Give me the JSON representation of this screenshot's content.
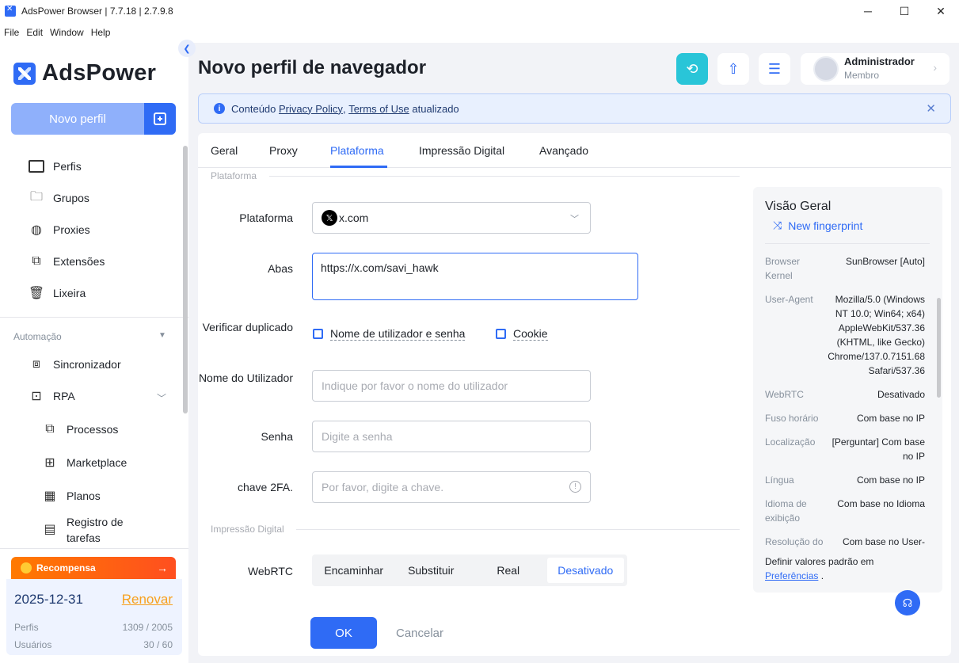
{
  "window": {
    "title": "AdsPower Browser | 7.7.18 | 2.7.9.8"
  },
  "menu": [
    "File",
    "Edit",
    "Window",
    "Help"
  ],
  "sidebar": {
    "logo": "AdsPower",
    "new_profile": "Novo perfil",
    "items": [
      {
        "label": "Perfis",
        "icon": "profiles-icon"
      },
      {
        "label": "Grupos",
        "icon": "folder-icon"
      },
      {
        "label": "Proxies",
        "icon": "globe-icon"
      },
      {
        "label": "Extensões",
        "icon": "puzzle-icon"
      },
      {
        "label": "Lixeira",
        "icon": "trash-icon"
      }
    ],
    "automation_label": "Automação",
    "automation_items": [
      {
        "label": "Sincronizador",
        "icon": "sync-icon"
      },
      {
        "label": "RPA",
        "icon": "robot-icon"
      }
    ],
    "rpa_sub": [
      {
        "label": "Processos",
        "icon": "process-icon"
      },
      {
        "label": "Marketplace",
        "icon": "store-icon"
      },
      {
        "label": "Planos",
        "icon": "calendar-icon"
      },
      {
        "label": "Registro de tarefas",
        "icon": "log-icon"
      }
    ],
    "reward": "Recompensa",
    "plan": {
      "date": "2025-12-31",
      "renew": "Renovar",
      "profiles_label": "Perfis",
      "profiles_value": "1309 / 2005",
      "users_label": "Usuários",
      "users_value": "30 / 60"
    }
  },
  "header": {
    "title": "Novo perfil de navegador",
    "user_name": "Administrador",
    "user_role": "Membro"
  },
  "notice": {
    "prefix": "Conteúdo",
    "link1": "Privacy Policy",
    "comma": ",",
    "link2": "Terms of Use",
    "suffix": "atualizado"
  },
  "tabs": [
    "Geral",
    "Proxy",
    "Plataforma",
    "Impressão Digital",
    "Avançado"
  ],
  "form": {
    "group_platform": "Plataforma",
    "platform_label": "Plataforma",
    "platform_value": "x.com",
    "tabs_label": "Abas",
    "tabs_value": "https://x.com/savi_hawk",
    "dup_label": "Verificar duplicado",
    "dup_opt1": "Nome de utilizador e senha",
    "dup_opt2": "Cookie",
    "user_label": "Nome do Utilizador",
    "user_placeholder": "Indique por favor o nome do utilizador",
    "pass_label": "Senha",
    "pass_placeholder": "Digite a senha",
    "twofa_label": "chave 2FA.",
    "twofa_placeholder": "Por favor, digite a chave.",
    "group_fp": "Impressão Digital",
    "webrtc_label": "WebRTC",
    "webrtc_options": [
      "Encaminhar",
      "Substituir",
      "Real",
      "Desativado"
    ],
    "ok": "OK",
    "cancel": "Cancelar"
  },
  "overview": {
    "title": "Visão Geral",
    "new_fp": "New fingerprint",
    "rows": [
      {
        "k": "Browser Kernel",
        "v": "SunBrowser [Auto]"
      },
      {
        "k": "User-Agent",
        "v": "Mozilla/5.0 (Windows NT 10.0; Win64; x64) AppleWebKit/537.36 (KHTML, like Gecko) Chrome/137.0.7151.68 Safari/537.36"
      },
      {
        "k": "WebRTC",
        "v": "Desativado"
      },
      {
        "k": "Fuso horário",
        "v": "Com base no IP"
      },
      {
        "k": "Localização",
        "v": "[Perguntar] Com base no IP"
      },
      {
        "k": "Língua",
        "v": "Com base no IP"
      },
      {
        "k": "Idioma de exibição",
        "v": "Com base no Idioma"
      },
      {
        "k": "Resolução do",
        "v": "Com base no User-"
      }
    ],
    "foot_text": "Definir valores padrão em",
    "foot_link": "Preferências",
    "foot_end": "."
  }
}
